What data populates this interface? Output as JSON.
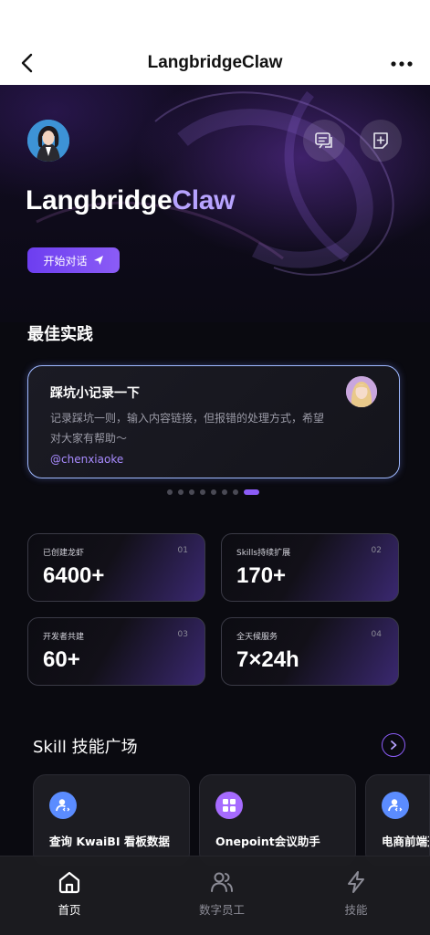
{
  "header": {
    "title": "LangbridgeClaw",
    "back_icon": "chevron-left-icon",
    "more_icon": "more-dots-icon"
  },
  "hero": {
    "brand_part1": "Langbridge",
    "brand_part2": "Claw",
    "start_button": "开始对话",
    "chat_icon": "chat-list-icon",
    "add_icon": "add-note-icon"
  },
  "best_practice": {
    "section_title": "最佳实践",
    "card": {
      "title": "踩坑小记录一下",
      "description": "记录踩坑一则，输入内容链接，但报错的处理方式，希望对大家有帮助～",
      "author": "@chenxiaoke"
    },
    "carousel": {
      "total": 8,
      "active_index": 7
    }
  },
  "stats": [
    {
      "label": "已创建龙虾",
      "num": "01",
      "value": "6400+"
    },
    {
      "label": "Skills持续扩展",
      "num": "02",
      "value": "170+"
    },
    {
      "label": "开发者共建",
      "num": "03",
      "value": "60+"
    },
    {
      "label": "全天候服务",
      "num": "04",
      "value": "7×24h"
    }
  ],
  "skills": {
    "section_title": "Skill 技能广场",
    "items": [
      {
        "name": "查询 KwaiBI 看板数据",
        "icon": "user-code-icon",
        "color": "#5b8cff"
      },
      {
        "name": "Onepoint会议助手",
        "icon": "grid-icon",
        "color": "#a66bff"
      },
      {
        "name": "电商前端开",
        "icon": "user-code-icon",
        "color": "#5b8cff"
      }
    ]
  },
  "nav": {
    "items": [
      {
        "label": "首页",
        "icon": "home-icon",
        "active": true
      },
      {
        "label": "数字员工",
        "icon": "users-icon",
        "active": false
      },
      {
        "label": "技能",
        "icon": "lightning-icon",
        "active": false
      }
    ]
  },
  "colors": {
    "accent": "#8b5cf6",
    "brand_highlight": "#b7a3ff",
    "background": "#0a0a10"
  }
}
